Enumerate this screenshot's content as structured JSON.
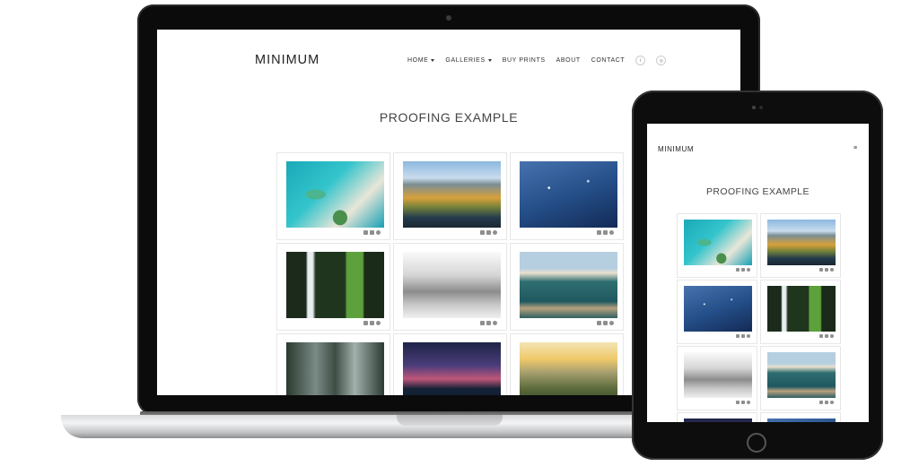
{
  "laptop": {
    "site": {
      "logo": "MINIMUM",
      "nav": [
        {
          "label": "HOME",
          "has_dropdown": true
        },
        {
          "label": "GALLERIES",
          "has_dropdown": true
        },
        {
          "label": "BUY PRINTS",
          "has_dropdown": false
        },
        {
          "label": "ABOUT",
          "has_dropdown": false
        },
        {
          "label": "CONTACT",
          "has_dropdown": false
        }
      ],
      "social_icons": [
        {
          "name": "twitter-icon",
          "glyph": "t"
        },
        {
          "name": "instagram-icon",
          "glyph": "◎"
        }
      ],
      "page_title": "PROOFING EXAMPLE"
    }
  },
  "tablet": {
    "site": {
      "logo": "MINIMUM",
      "menu_icon": "≡",
      "page_title": "PROOFING EXAMPLE"
    }
  },
  "colors": {
    "background": "#ffffff",
    "text_dark": "#222222",
    "device_black": "#0b0b0b"
  }
}
